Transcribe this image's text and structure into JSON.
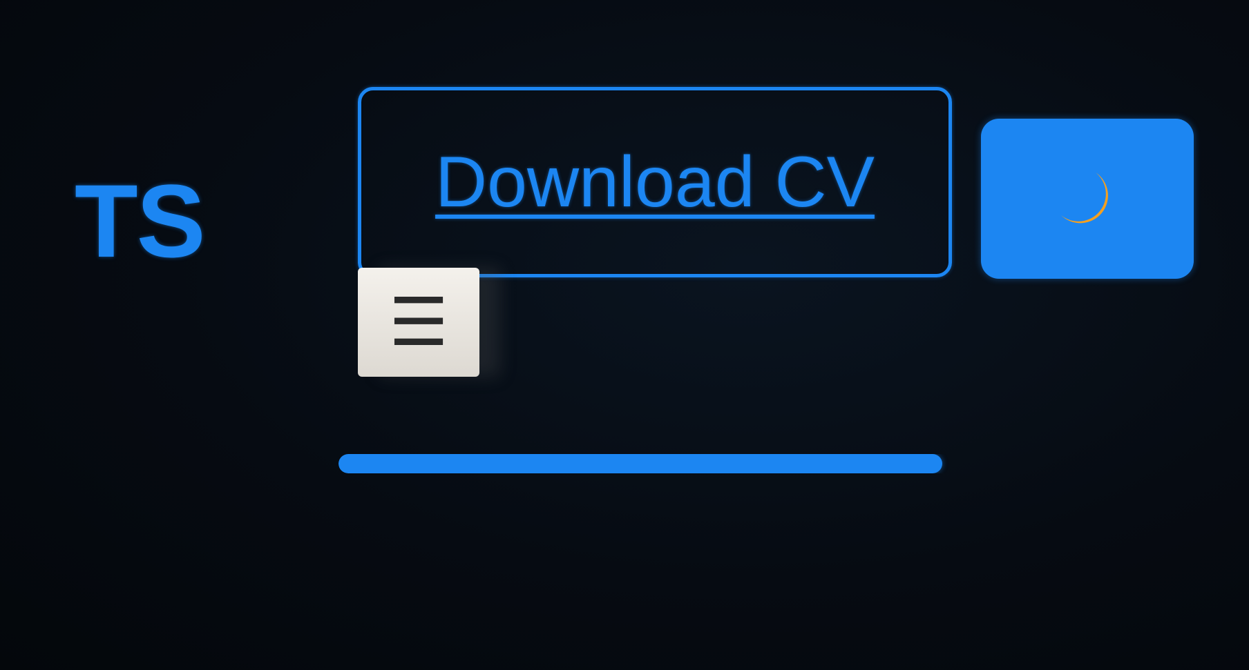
{
  "header": {
    "logo_text": "TS",
    "download_label": "Download CV",
    "theme_toggle_icon": "moon-icon",
    "menu_icon": "hamburger-menu-icon",
    "menu_glyph": "☰"
  },
  "progress": {
    "fraction": 0.95
  },
  "colors": {
    "accent": "#1c86f2",
    "background": "#05090e",
    "moon": "#f5a020",
    "menu_button": "#ece9e4"
  }
}
